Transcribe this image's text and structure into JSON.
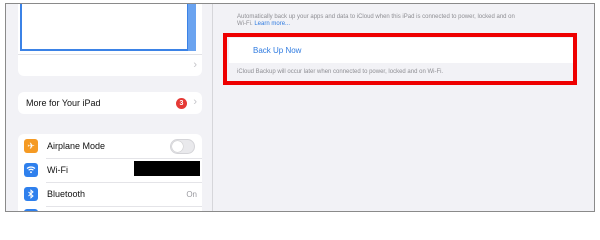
{
  "sidebar": {
    "more_for_ipad": {
      "label": "More for Your iPad",
      "badge": "3"
    },
    "settings": [
      {
        "label": "Airplane Mode",
        "icon": "airplane-icon",
        "toggle_on": false
      },
      {
        "label": "Wi-Fi",
        "icon": "wifi-icon",
        "value": ""
      },
      {
        "label": "Bluetooth",
        "icon": "bluetooth-icon",
        "value": "On"
      }
    ]
  },
  "main": {
    "backup_description_line1": "Automatically back up your apps and data to iCloud when this iPad is connected to power, locked and on",
    "backup_description_line2": "Wi-Fi.",
    "learn_more": "Learn more...",
    "back_up_now": "Back Up Now",
    "footer_note": "iCloud Backup will occur later when connected to power, locked and on Wi-Fi."
  },
  "colors": {
    "accent": "#2f7be0",
    "highlight": "#ee0000",
    "badge": "#e53935",
    "airplane_icon_bg": "#f59a23",
    "wifi_icon_bg": "#2f80ed",
    "bluetooth_icon_bg": "#2f80ed"
  }
}
